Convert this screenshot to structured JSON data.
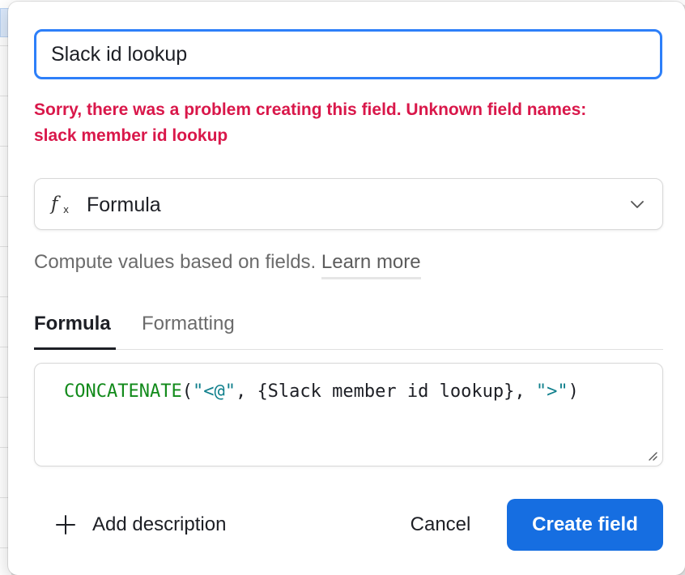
{
  "field_editor": {
    "name_value": "Slack id lookup",
    "error_line1": "Sorry, there was a problem creating this field. Unknown field names:",
    "error_line2": "slack member id lookup",
    "type": {
      "icon": "formula-fx-icon",
      "label": "Formula"
    },
    "help_text": "Compute values based on fields.",
    "learn_more_label": "Learn more",
    "tabs": [
      {
        "label": "Formula",
        "active": true
      },
      {
        "label": "Formatting",
        "active": false
      }
    ],
    "formula": {
      "function_name": "CONCATENATE",
      "open_paren": "(",
      "string1": "\"<@\"",
      "separator1": ", ",
      "field_ref": "{Slack member id lookup}",
      "separator2": ", ",
      "string2": "\">\"",
      "close_paren": ")"
    },
    "add_description_label": "Add description",
    "cancel_label": "Cancel",
    "create_label": "Create field"
  },
  "colors": {
    "accent": "#2d7ff9",
    "primary_button": "#166ee1",
    "error": "#d9174a",
    "formula_function": "#118a1a",
    "formula_string": "#0f7f8c"
  }
}
